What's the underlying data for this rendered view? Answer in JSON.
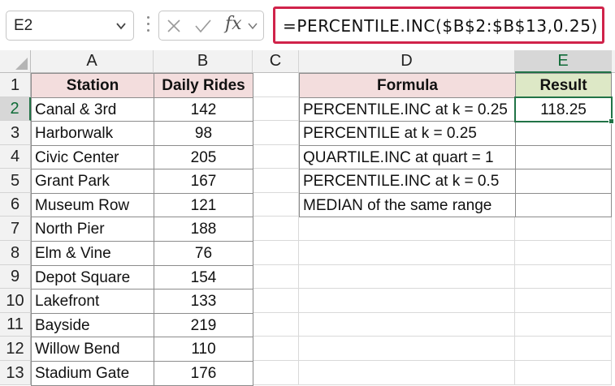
{
  "name_box": {
    "value": "E2"
  },
  "formula_bar": {
    "fx_label": "fx",
    "formula": "=PERCENTILE.INC($B$2:$B$13,0.25)"
  },
  "columns": [
    "A",
    "B",
    "C",
    "D",
    "E"
  ],
  "rows": [
    "1",
    "2",
    "3",
    "4",
    "5",
    "6",
    "7",
    "8",
    "9",
    "10",
    "11",
    "12",
    "13"
  ],
  "table_left": {
    "headers": {
      "station": "Station",
      "rides": "Daily Rides"
    },
    "rows": [
      {
        "station": "Canal & 3rd",
        "rides": "142"
      },
      {
        "station": "Harborwalk",
        "rides": "98"
      },
      {
        "station": "Civic Center",
        "rides": "205"
      },
      {
        "station": "Grant Park",
        "rides": "167"
      },
      {
        "station": "Museum Row",
        "rides": "121"
      },
      {
        "station": "North Pier",
        "rides": "188"
      },
      {
        "station": "Elm & Vine",
        "rides": "76"
      },
      {
        "station": "Depot Square",
        "rides": "154"
      },
      {
        "station": "Lakefront",
        "rides": "133"
      },
      {
        "station": "Bayside",
        "rides": "219"
      },
      {
        "station": "Willow Bend",
        "rides": "110"
      },
      {
        "station": "Stadium Gate",
        "rides": "176"
      }
    ]
  },
  "table_right": {
    "headers": {
      "formula": "Formula",
      "result": "Result"
    },
    "rows": [
      {
        "formula": "PERCENTILE.INC at k = 0.25",
        "result": "118.25"
      },
      {
        "formula": "PERCENTILE at k = 0.25",
        "result": ""
      },
      {
        "formula": "QUARTILE.INC at quart = 1",
        "result": ""
      },
      {
        "formula": "PERCENTILE.INC at k = 0.5",
        "result": ""
      },
      {
        "formula": "MEDIAN of the same range",
        "result": ""
      }
    ]
  },
  "colors": {
    "accent_green": "#217346",
    "formula_highlight": "#d0234a",
    "header_pink": "#f3dddd",
    "header_green": "#dde8c6"
  },
  "icons": [
    "chevron-down-icon",
    "cancel-x-icon",
    "enter-check-icon",
    "chevron-down-icon"
  ]
}
